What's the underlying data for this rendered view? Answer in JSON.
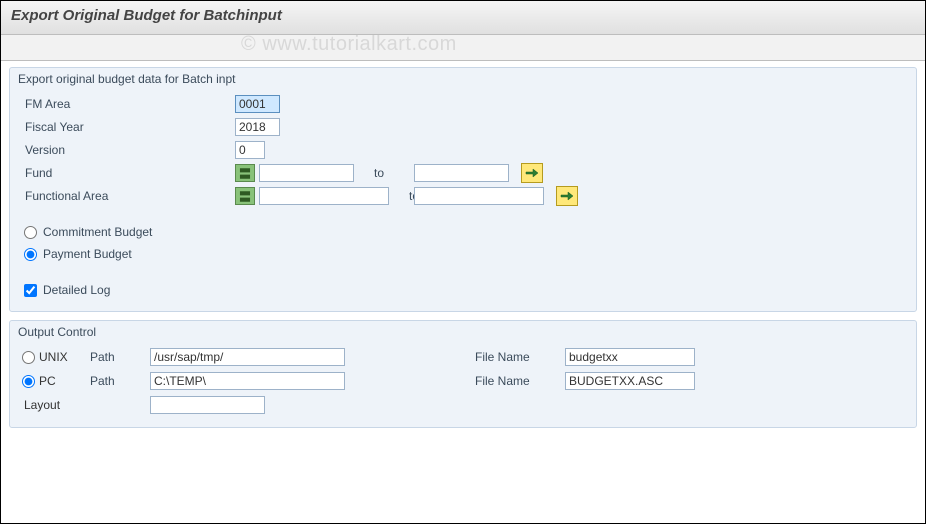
{
  "title": "Export Original Budget for Batchinput",
  "watermark": "© www.tutorialkart.com",
  "group1": {
    "title": "Export original budget data for Batch inpt",
    "fm_area_label": "FM Area",
    "fm_area_value": "0001",
    "fiscal_year_label": "Fiscal Year",
    "fiscal_year_value": "2018",
    "version_label": "Version",
    "version_value": "0",
    "fund_label": "Fund",
    "fund_from": "",
    "fund_to": "",
    "funcarea_label": "Functional Area",
    "funcarea_from": "",
    "funcarea_to": "",
    "to_label": "to",
    "commitment_label": "Commitment Budget",
    "payment_label": "Payment Budget",
    "detailed_log_label": "Detailed Log"
  },
  "group2": {
    "title": "Output Control",
    "unix_label": "UNIX",
    "pc_label": "PC",
    "path_label": "Path",
    "filename_label": "File Name",
    "unix_path": "/usr/sap/tmp/",
    "unix_filename": "budgetxx",
    "pc_path": "C:\\TEMP\\",
    "pc_filename": "BUDGETXX.ASC",
    "layout_label": "Layout",
    "layout_value": ""
  }
}
